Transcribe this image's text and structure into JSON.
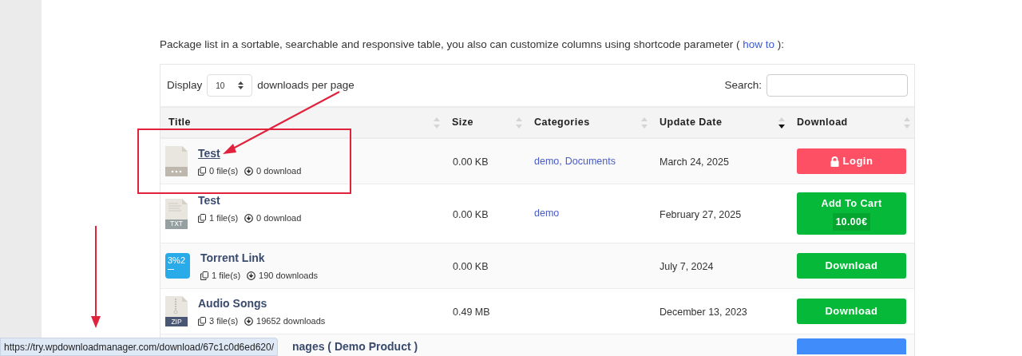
{
  "intro": {
    "text": "Package list in a sortable, searchable and responsive table, you also can customize columns using shortcode parameter (",
    "link": "how to",
    "tail": "):"
  },
  "display": {
    "label": "Display",
    "value": "10",
    "suffix": "downloads per page"
  },
  "search": {
    "label": "Search:"
  },
  "columns": [
    {
      "label": "Title",
      "sorted": false
    },
    {
      "label": "Size",
      "sorted": false
    },
    {
      "label": "Categories",
      "sorted": false
    },
    {
      "label": "Update Date",
      "sorted": true
    },
    {
      "label": "Download",
      "sorted": false
    }
  ],
  "rows": [
    {
      "kind": "full",
      "icon": {
        "kind": "blank"
      },
      "title": "Test",
      "hovered": true,
      "files": "0 file(s)",
      "downloads": "0 download",
      "size": "0.00 KB",
      "categories": [
        "demo,",
        "Documents"
      ],
      "date": "March 24, 2025",
      "action": {
        "kind": "login",
        "label": "Login"
      }
    },
    {
      "kind": "full",
      "icon": {
        "kind": "doc",
        "label": "TXT"
      },
      "title": "Test",
      "hovered": false,
      "files": "1 file(s)",
      "downloads": "0 download",
      "size": "0.00 KB",
      "categories": [
        "demo"
      ],
      "date": "February 27, 2025",
      "action": {
        "kind": "cart",
        "label": "Add To Cart",
        "price": "10.00€"
      }
    },
    {
      "kind": "full",
      "icon": {
        "kind": "image",
        "label": "3%2"
      },
      "title": "Torrent Link",
      "hovered": false,
      "files": "1 file(s)",
      "downloads": "190 downloads",
      "size": "0.00 KB",
      "categories": [],
      "date": "July 7, 2024",
      "action": {
        "kind": "download",
        "label": "Download"
      }
    },
    {
      "kind": "full",
      "icon": {
        "kind": "zip",
        "label": "ZIP"
      },
      "title": "Audio Songs",
      "hovered": false,
      "files": "3 file(s)",
      "downloads": "19652 downloads",
      "size": "0.49 MB",
      "categories": [],
      "date": "December 13, 2023",
      "action": {
        "kind": "download",
        "label": "Download"
      }
    },
    {
      "kind": "partial",
      "title_visible_part": "nages ( Demo Product )",
      "action": {
        "kind": "blue"
      }
    }
  ],
  "status_bar": {
    "url": "https://try.wpdownloadmanager.com/download/67c1c0d6ed620/"
  }
}
